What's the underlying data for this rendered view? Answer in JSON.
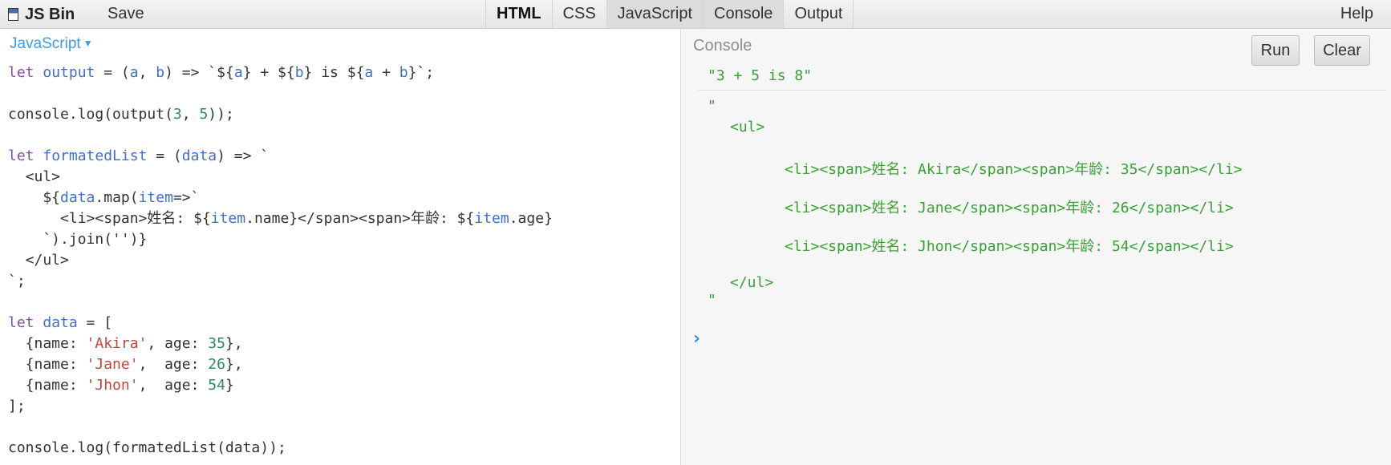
{
  "toolbar": {
    "app_name": "JS Bin",
    "save_label": "Save",
    "tabs": [
      {
        "label": "HTML",
        "bold": true
      },
      {
        "label": "CSS"
      },
      {
        "label": "JavaScript"
      },
      {
        "label": "Console"
      },
      {
        "label": "Output"
      }
    ],
    "help_label": "Help"
  },
  "editor": {
    "language_label": "JavaScript",
    "lines": [
      [
        {
          "t": "let ",
          "c": "kw"
        },
        {
          "t": "output",
          "c": "vr"
        },
        {
          "t": " = ("
        },
        {
          "t": "a",
          "c": "vr"
        },
        {
          "t": ", "
        },
        {
          "t": "b",
          "c": "vr"
        },
        {
          "t": ") => `${"
        },
        {
          "t": "a",
          "c": "vr"
        },
        {
          "t": "} + ${"
        },
        {
          "t": "b",
          "c": "vr"
        },
        {
          "t": "} is ${"
        },
        {
          "t": "a",
          "c": "vr"
        },
        {
          "t": " + "
        },
        {
          "t": "b",
          "c": "vr"
        },
        {
          "t": "}`;"
        }
      ],
      [],
      [
        {
          "t": "console.log(output("
        },
        {
          "t": "3",
          "c": "num"
        },
        {
          "t": ", "
        },
        {
          "t": "5",
          "c": "num"
        },
        {
          "t": "));"
        }
      ],
      [],
      [
        {
          "t": "let ",
          "c": "kw"
        },
        {
          "t": "formatedList",
          "c": "vr"
        },
        {
          "t": " = ("
        },
        {
          "t": "data",
          "c": "vr"
        },
        {
          "t": ") => `"
        }
      ],
      [
        {
          "t": "  <ul>"
        }
      ],
      [
        {
          "t": "    ${"
        },
        {
          "t": "data",
          "c": "vr"
        },
        {
          "t": ".map("
        },
        {
          "t": "item",
          "c": "vr"
        },
        {
          "t": "=>`"
        }
      ],
      [
        {
          "t": "      <li><span>姓名: ${"
        },
        {
          "t": "item",
          "c": "vr"
        },
        {
          "t": ".name}</span><span>年龄: ${"
        },
        {
          "t": "item",
          "c": "vr"
        },
        {
          "t": ".age}"
        }
      ],
      [
        {
          "t": "    `).join('')}"
        }
      ],
      [
        {
          "t": "  </ul>"
        }
      ],
      [
        {
          "t": "`;"
        }
      ],
      [],
      [
        {
          "t": "let ",
          "c": "kw"
        },
        {
          "t": "data",
          "c": "vr"
        },
        {
          "t": " = ["
        }
      ],
      [
        {
          "t": "  {name: "
        },
        {
          "t": "'Akira'",
          "c": "str"
        },
        {
          "t": ", age: "
        },
        {
          "t": "35",
          "c": "num"
        },
        {
          "t": "},"
        }
      ],
      [
        {
          "t": "  {name: "
        },
        {
          "t": "'Jane'",
          "c": "str"
        },
        {
          "t": ",  age: "
        },
        {
          "t": "26",
          "c": "num"
        },
        {
          "t": "},"
        }
      ],
      [
        {
          "t": "  {name: "
        },
        {
          "t": "'Jhon'",
          "c": "str"
        },
        {
          "t": ",  age: "
        },
        {
          "t": "54",
          "c": "num"
        },
        {
          "t": "}"
        }
      ],
      [
        {
          "t": "];"
        }
      ],
      [],
      [
        {
          "t": "console.log(formatedList(data));"
        }
      ]
    ]
  },
  "console": {
    "label": "Console",
    "run_label": "Run",
    "clear_label": "Clear",
    "output1": "\"3 + 5 is 8\"",
    "quote_open": "\"",
    "ul_open": "<ul>",
    "li_items": [
      "<li><span>姓名: Akira</span><span>年龄: 35</span></li>",
      "<li><span>姓名: Jane</span><span>年龄: 26</span></li>",
      "<li><span>姓名: Jhon</span><span>年龄: 54</span></li>"
    ],
    "ul_close": "</ul>",
    "quote_close": "\"",
    "prompt": "›"
  },
  "colors": {
    "keyword": "#8a4ea8",
    "variable": "#3f6fc9",
    "string": "#c5443c",
    "number": "#2f8a5a",
    "console_output": "#3aa135",
    "panel_label": "#3d9be9"
  }
}
